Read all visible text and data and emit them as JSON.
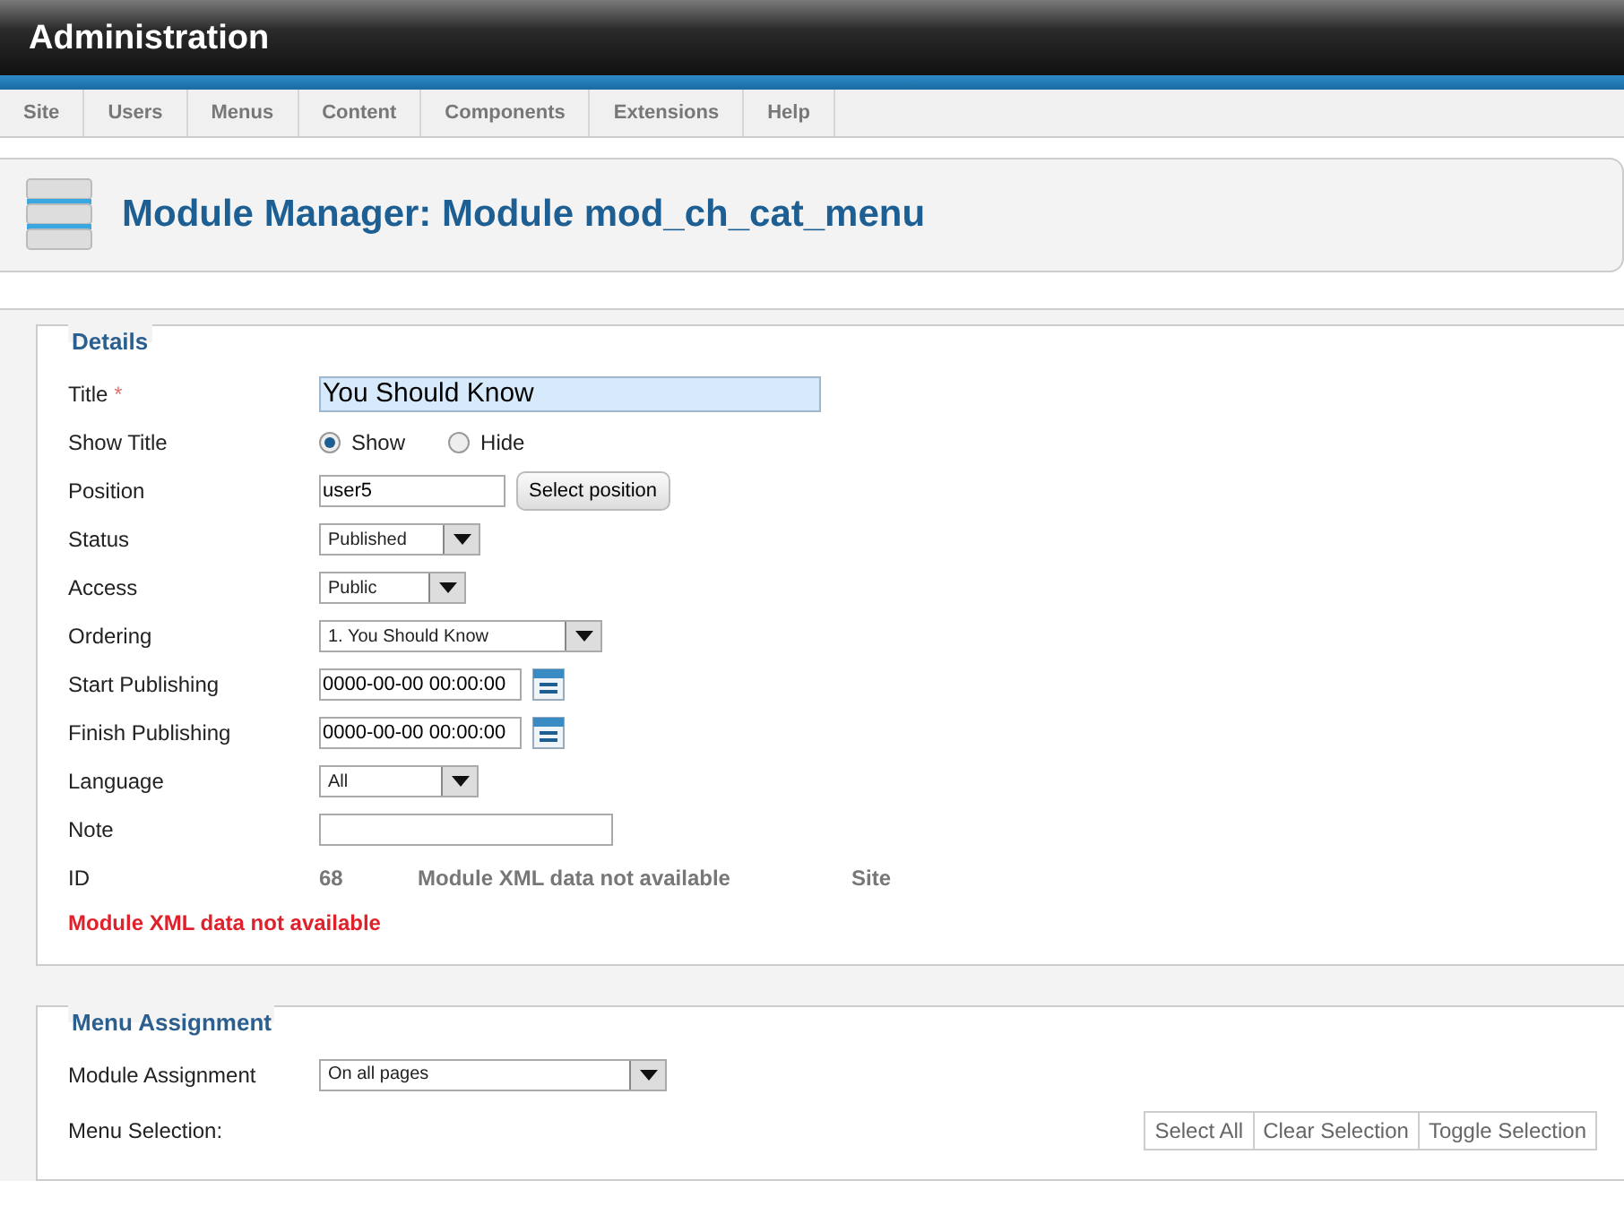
{
  "header": {
    "title": "Administration"
  },
  "menu": [
    {
      "label": "Site"
    },
    {
      "label": "Users"
    },
    {
      "label": "Menus"
    },
    {
      "label": "Content"
    },
    {
      "label": "Components"
    },
    {
      "label": "Extensions"
    },
    {
      "label": "Help"
    }
  ],
  "page_title": "Module Manager: Module mod_ch_cat_menu",
  "details": {
    "legend": "Details",
    "fields": [
      {
        "kind": "text",
        "label": "Title",
        "required_mark": "*",
        "value": "You Should Know",
        "highlighted": true
      },
      {
        "kind": "radio",
        "label": "Show Title",
        "options": [
          {
            "label": "Show",
            "selected": true
          },
          {
            "label": "Hide",
            "selected": false
          }
        ]
      },
      {
        "kind": "text",
        "label": "Position",
        "value": "user5",
        "button": "Select position",
        "highlighted": false
      },
      {
        "kind": "select",
        "label": "Status",
        "value": "Published"
      },
      {
        "kind": "select",
        "label": "Access",
        "value": "Public"
      },
      {
        "kind": "select",
        "label": "Ordering",
        "value": "1. You Should Know"
      },
      {
        "kind": "date",
        "label": "Start Publishing",
        "value": "0000-00-00 00:00:00"
      },
      {
        "kind": "date",
        "label": "Finish Publishing",
        "value": "0000-00-00 00:00:00"
      },
      {
        "kind": "select",
        "label": "Language",
        "value": "All"
      },
      {
        "kind": "text",
        "label": "Note",
        "highlighted": false
      },
      {
        "kind": "info",
        "label": "ID",
        "values": [
          "68",
          "Module XML data not available",
          "Site"
        ]
      }
    ],
    "error": "Module XML data not available"
  },
  "menu_assignment": {
    "legend": "Menu Assignment",
    "fields": [
      {
        "kind": "select",
        "label": "Module Assignment",
        "value": "On all pages"
      }
    ],
    "selection_label": "Menu Selection:",
    "buttons": [
      "Select All",
      "Clear Selection",
      "Toggle Selection"
    ]
  }
}
